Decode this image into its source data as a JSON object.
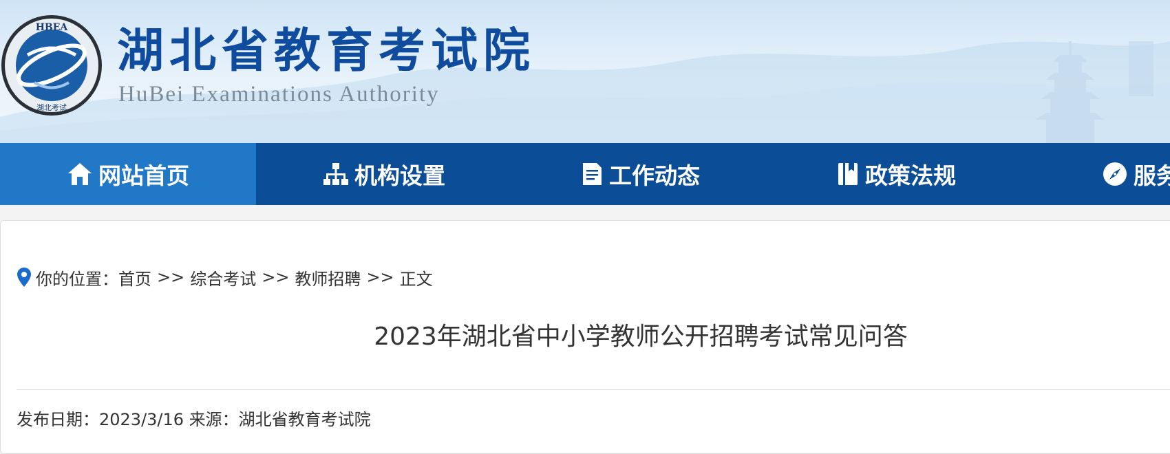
{
  "header": {
    "emblem_text": "HBEA",
    "emblem_subtext": "湖北考试",
    "title": "湖北省教育考试院",
    "subtitle": "HuBei Examinations Authority"
  },
  "nav": {
    "items": [
      {
        "label": "网站首页",
        "icon": "home-icon",
        "active": true
      },
      {
        "label": "机构设置",
        "icon": "org-chart-icon",
        "active": false
      },
      {
        "label": "工作动态",
        "icon": "document-icon",
        "active": false
      },
      {
        "label": "政策法规",
        "icon": "book-icon",
        "active": false
      },
      {
        "label": "服务",
        "icon": "compass-icon",
        "active": false
      }
    ]
  },
  "breadcrumb": {
    "prefix": "你的位置：",
    "items": [
      "首页",
      "综合考试",
      "教师招聘",
      "正文"
    ],
    "separator": ">>"
  },
  "article": {
    "title": "2023年湖北省中小学教师公开招聘考试常见问答",
    "meta": "发布日期：2023/3/16 来源：湖北省教育考试院"
  },
  "colors": {
    "nav_bg": "#0b4e97",
    "nav_active": "#2178c7",
    "title_blue": "#0f4c9e"
  }
}
